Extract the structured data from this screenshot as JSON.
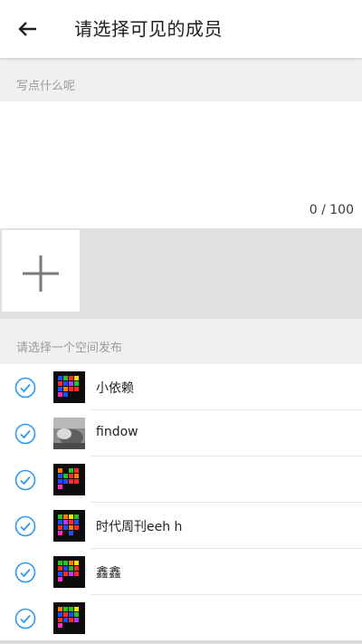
{
  "header": {
    "title": "请选择可见的成员",
    "back_icon": "arrow-left-icon"
  },
  "compose": {
    "placeholder": "写点什么呢",
    "counter": "0 / 100"
  },
  "photos": {
    "add_icon": "plus-icon"
  },
  "members_section": {
    "label": "请选择一个空间发布"
  },
  "members": [
    {
      "name": "小依赖",
      "checked": true,
      "avatar": "pixel-grid"
    },
    {
      "name": "findow",
      "checked": true,
      "avatar": "photo"
    },
    {
      "name": "",
      "checked": true,
      "avatar": "pixel-grid"
    },
    {
      "name": "时代周刊eeh h",
      "checked": true,
      "avatar": "pixel-grid"
    },
    {
      "name": "鑫鑫",
      "checked": true,
      "avatar": "pixel-grid"
    },
    {
      "name": "",
      "checked": true,
      "avatar": "pixel-grid"
    }
  ],
  "colors": {
    "accent": "#2b9af3"
  }
}
